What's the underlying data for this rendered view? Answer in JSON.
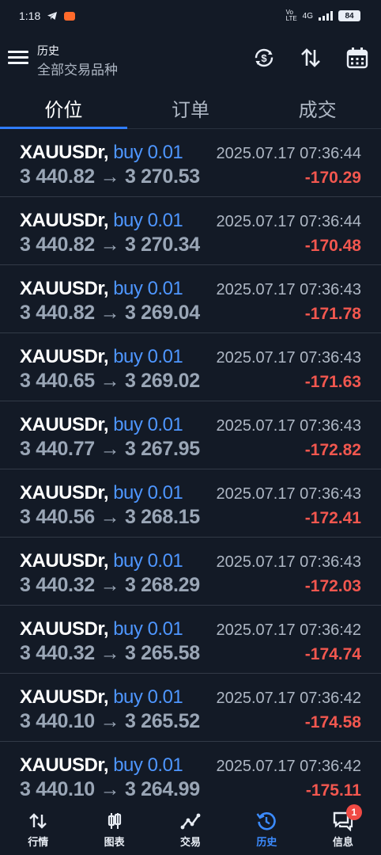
{
  "status_bar": {
    "time": "1:18",
    "network": "4G",
    "volte": "Vo LTE",
    "battery": "84"
  },
  "header": {
    "title_small": "历史",
    "title_main": "全部交易品种"
  },
  "tabs": [
    "价位",
    "订单",
    "成交"
  ],
  "deals": [
    {
      "symbol": "XAUUSDr,",
      "side": "buy 0.01",
      "open": "3 440.82",
      "close": "3 270.53",
      "time": "2025.07.17 07:36:44",
      "profit": "-170.29"
    },
    {
      "symbol": "XAUUSDr,",
      "side": "buy 0.01",
      "open": "3 440.82",
      "close": "3 270.34",
      "time": "2025.07.17 07:36:44",
      "profit": "-170.48"
    },
    {
      "symbol": "XAUUSDr,",
      "side": "buy 0.01",
      "open": "3 440.82",
      "close": "3 269.04",
      "time": "2025.07.17 07:36:43",
      "profit": "-171.78"
    },
    {
      "symbol": "XAUUSDr,",
      "side": "buy 0.01",
      "open": "3 440.65",
      "close": "3 269.02",
      "time": "2025.07.17 07:36:43",
      "profit": "-171.63"
    },
    {
      "symbol": "XAUUSDr,",
      "side": "buy 0.01",
      "open": "3 440.77",
      "close": "3 267.95",
      "time": "2025.07.17 07:36:43",
      "profit": "-172.82"
    },
    {
      "symbol": "XAUUSDr,",
      "side": "buy 0.01",
      "open": "3 440.56",
      "close": "3 268.15",
      "time": "2025.07.17 07:36:43",
      "profit": "-172.41"
    },
    {
      "symbol": "XAUUSDr,",
      "side": "buy 0.01",
      "open": "3 440.32",
      "close": "3 268.29",
      "time": "2025.07.17 07:36:43",
      "profit": "-172.03"
    },
    {
      "symbol": "XAUUSDr,",
      "side": "buy 0.01",
      "open": "3 440.32",
      "close": "3 265.58",
      "time": "2025.07.17 07:36:42",
      "profit": "-174.74"
    },
    {
      "symbol": "XAUUSDr,",
      "side": "buy 0.01",
      "open": "3 440.10",
      "close": "3 265.52",
      "time": "2025.07.17 07:36:42",
      "profit": "-174.58"
    },
    {
      "symbol": "XAUUSDr,",
      "side": "buy 0.01",
      "open": "3 440.10",
      "close": "3 264.99",
      "time": "2025.07.17 07:36:42",
      "profit": "-175.11"
    }
  ],
  "arrow": "→",
  "bottom_nav": [
    {
      "label": "行情",
      "icon": "quotes-icon"
    },
    {
      "label": "图表",
      "icon": "chart-icon"
    },
    {
      "label": "交易",
      "icon": "trade-icon"
    },
    {
      "label": "历史",
      "icon": "history-icon"
    },
    {
      "label": "信息",
      "icon": "messages-icon"
    }
  ],
  "messages_badge": "1",
  "colors": {
    "background": "#131a26",
    "accent": "#2f7dff",
    "buy": "#4e96ff",
    "loss": "#f2574f"
  }
}
